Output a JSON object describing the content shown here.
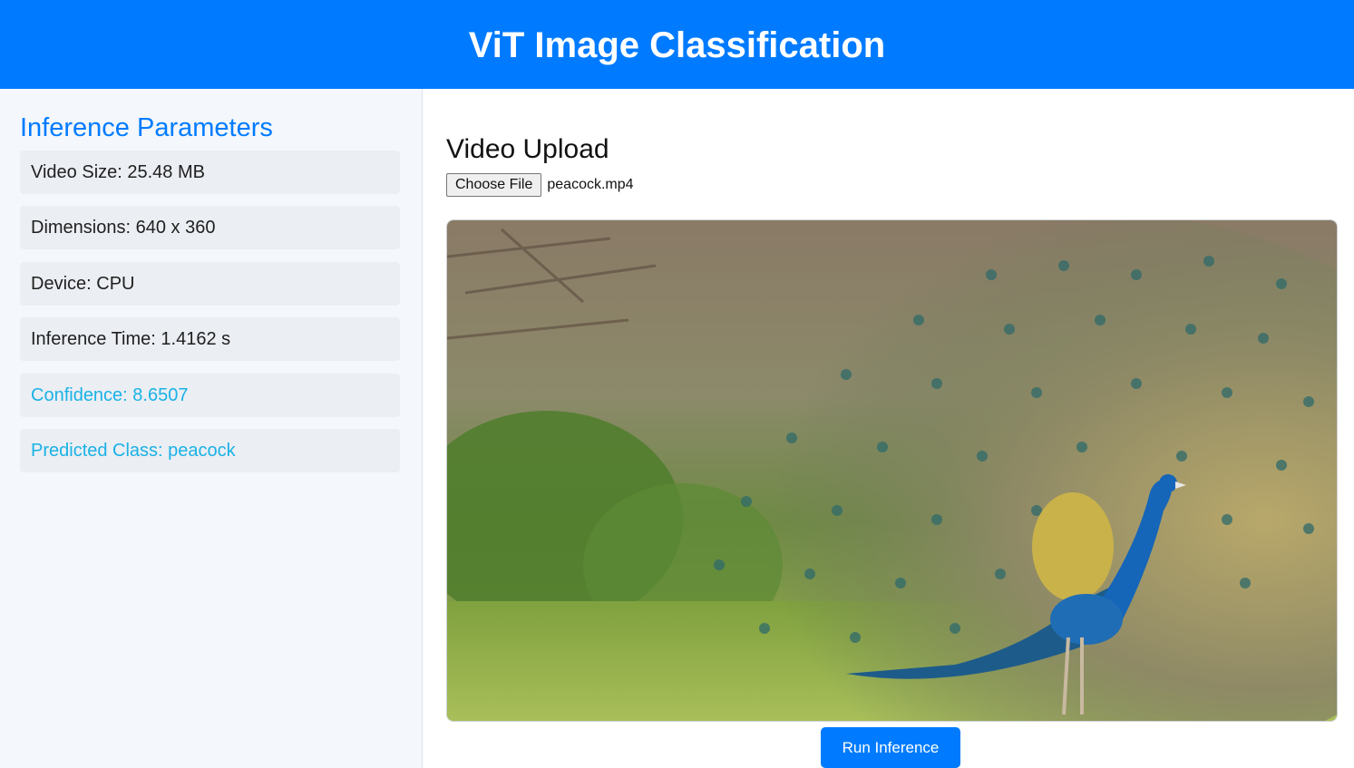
{
  "header": {
    "title": "ViT Image Classification"
  },
  "sidebar": {
    "title": "Inference Parameters",
    "params": [
      {
        "text": "Video Size: 25.48 MB"
      },
      {
        "text": "Dimensions: 640 x 360"
      },
      {
        "text": "Device: CPU"
      },
      {
        "text": "Inference Time: 1.4162 s"
      },
      {
        "text": "Confidence: 8.6507"
      },
      {
        "text": "Predicted Class: peacock"
      }
    ]
  },
  "main": {
    "section_title": "Video Upload",
    "choose_file_label": "Choose File",
    "file_name": "peacock.mp4",
    "run_button_label": "Run Inference"
  },
  "colors": {
    "primary": "#007bff",
    "highlight_text": "#1ab2e6",
    "sidebar_bg": "#f4f7fb",
    "param_bg": "#ebeef3"
  }
}
